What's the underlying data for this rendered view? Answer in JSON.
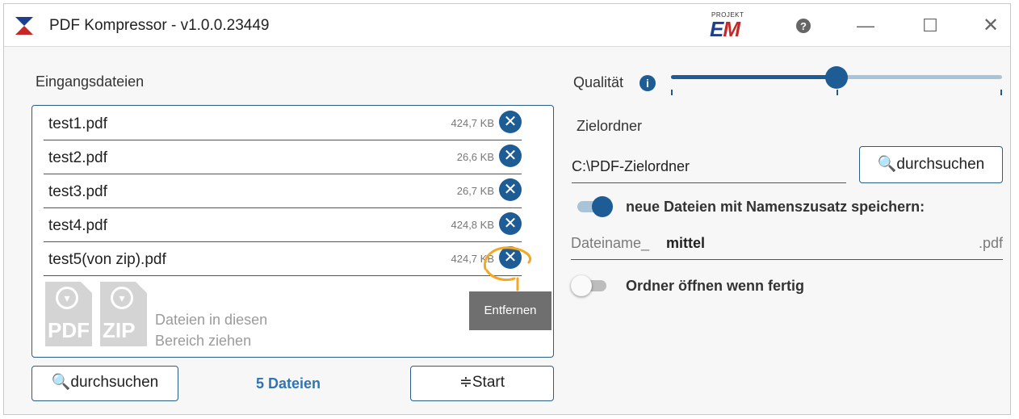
{
  "window": {
    "title": "PDF Kompressor - v1.0.0.23449",
    "brand_small": "PROJEKT",
    "brand_e": "E",
    "brand_m": "M",
    "help_icon": "help-icon",
    "minimize_glyph": "—",
    "maximize_glyph": "☐",
    "close_glyph": "✕"
  },
  "input": {
    "label": "Eingangsdateien",
    "files": [
      {
        "name": "test1.pdf",
        "size": "424,7 KB"
      },
      {
        "name": "test2.pdf",
        "size": "26,6 KB"
      },
      {
        "name": "test3.pdf",
        "size": "26,7 KB"
      },
      {
        "name": "test4.pdf",
        "size": "424,8 KB"
      },
      {
        "name": "test5(von zip).pdf",
        "size": "424,7 KB"
      }
    ],
    "remove_glyph": "✕",
    "drop_icons": [
      "PDF",
      "ZIP"
    ],
    "drop_hint_line1": "Dateien in diesen",
    "drop_hint_line2": "Bereich ziehen",
    "tooltip": "Entfernen",
    "browse_label": "🔍durchsuchen",
    "count_label": "5 Dateien",
    "start_label": "≑Start"
  },
  "settings": {
    "quality_label": "Qualität",
    "quality_level": 0.5,
    "quality_ticks": 3,
    "info_glyph": "i",
    "target_label": "Zielordner",
    "target_value": "C:\\PDF-Zielordner",
    "browse_label": "🔍durchsuchen",
    "suffix_toggle_on": true,
    "suffix_label": "neue Dateien mit Namenszusatz speichern:",
    "name_prefix": "Dateiname_",
    "name_value": "mittel",
    "name_ext": ".pdf",
    "open_toggle_on": false,
    "open_label": "Ordner öffnen wenn fertig"
  },
  "colors": {
    "accent": "#1d5c95",
    "annotation": "#f5a623",
    "count": "#2f74b5"
  }
}
